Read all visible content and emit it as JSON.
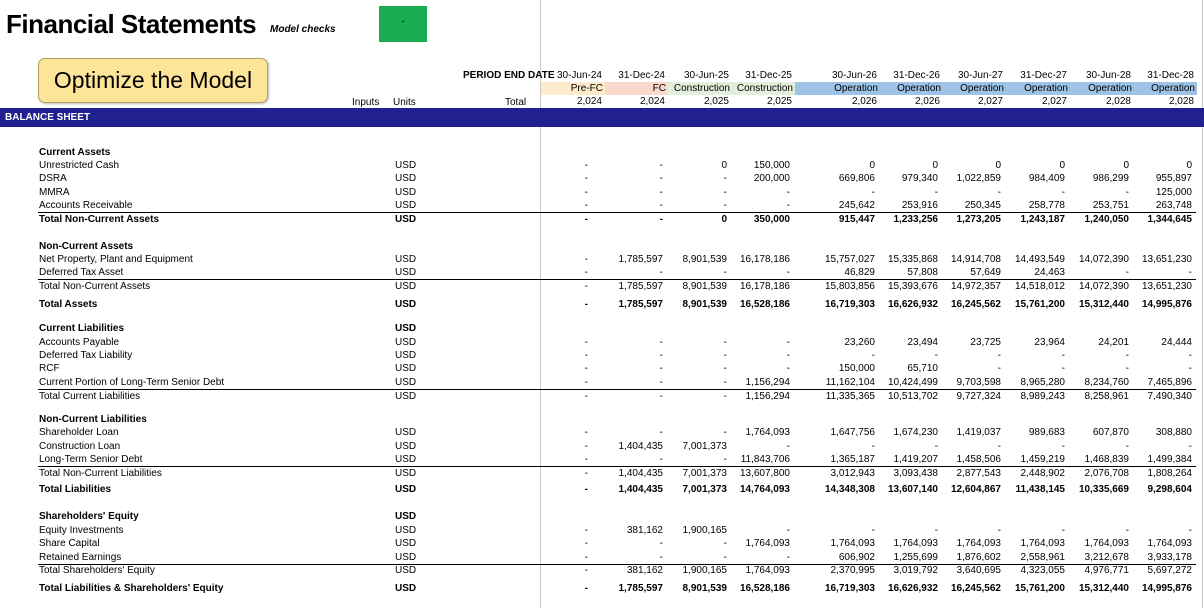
{
  "header": {
    "title": "Financial Statements",
    "model_checks_label": "Model checks",
    "model_checks_value": "-",
    "optimize_button": "Optimize the Model",
    "period_end_label": "PERIOD END DATE",
    "inputs_label": "Inputs",
    "units_label": "Units",
    "total_label": "Total"
  },
  "colors": {
    "section_bar": "#202090",
    "check_ok": "#1aae50",
    "button_fill": "#fce599",
    "phase_pre_fc": "#fdebcb",
    "phase_fc": "#f9d9cc",
    "phase_construction": "#e2efda",
    "phase_operation": "#9dc3e6"
  },
  "periods": [
    {
      "date": "30-Jun-24",
      "phase": "Pre-FC",
      "year": "2,024",
      "phase_color": "#fdebcb"
    },
    {
      "date": "31-Dec-24",
      "phase": "FC",
      "year": "2,024",
      "phase_color": "#f9d9cc"
    },
    {
      "date": "30-Jun-25",
      "phase": "Construction",
      "year": "2,025",
      "phase_color": "#e2efda"
    },
    {
      "date": "31-Dec-25",
      "phase": "Construction",
      "year": "2,025",
      "phase_color": "#e2efda"
    },
    {
      "date": "30-Jun-26",
      "phase": "Operation",
      "year": "2,026",
      "phase_color": "#9dc3e6"
    },
    {
      "date": "31-Dec-26",
      "phase": "Operation",
      "year": "2,026",
      "phase_color": "#9dc3e6"
    },
    {
      "date": "30-Jun-27",
      "phase": "Operation",
      "year": "2,027",
      "phase_color": "#9dc3e6"
    },
    {
      "date": "31-Dec-27",
      "phase": "Operation",
      "year": "2,027",
      "phase_color": "#9dc3e6"
    },
    {
      "date": "30-Jun-28",
      "phase": "Operation",
      "year": "2,028",
      "phase_color": "#9dc3e6"
    },
    {
      "date": "31-Dec-28",
      "phase": "Operation",
      "year": "2,028",
      "phase_color": "#9dc3e6"
    }
  ],
  "section_title": "BALANCE SHEET",
  "rows": [
    {
      "label": "Current Assets",
      "type": "heading"
    },
    {
      "label": "Unrestricted Cash",
      "units": "USD",
      "total": "-",
      "values": [
        "-",
        "0",
        "150,000",
        "0",
        "0",
        "0",
        "0",
        "0",
        "0"
      ]
    },
    {
      "label": "DSRA",
      "units": "USD",
      "total": "-",
      "values": [
        "-",
        "-",
        "200,000",
        "669,806",
        "979,340",
        "1,022,859",
        "984,409",
        "986,299",
        "955,897"
      ]
    },
    {
      "label": "MMRA",
      "units": "USD",
      "total": "-",
      "values": [
        "-",
        "-",
        "-",
        "-",
        "-",
        "-",
        "-",
        "-",
        "125,000"
      ]
    },
    {
      "label": "Accounts Receivable",
      "units": "USD",
      "total": "-",
      "values": [
        "-",
        "-",
        "-",
        "245,642",
        "253,916",
        "250,345",
        "258,778",
        "253,751",
        "263,748"
      ],
      "underline": true
    },
    {
      "label": "Total Non-Current Assets",
      "units": "USD",
      "total": "-",
      "values": [
        "-",
        "0",
        "350,000",
        "915,447",
        "1,233,256",
        "1,273,205",
        "1,243,187",
        "1,240,050",
        "1,344,645"
      ],
      "bold": true
    },
    {
      "label": "Non-Current Assets",
      "type": "heading"
    },
    {
      "label": "Net Property, Plant and Equipment",
      "units": "USD",
      "total": "-",
      "values": [
        "1,785,597",
        "8,901,539",
        "16,178,186",
        "15,757,027",
        "15,335,868",
        "14,914,708",
        "14,493,549",
        "14,072,390",
        "13,651,230"
      ]
    },
    {
      "label": "Deferred Tax Asset",
      "units": "USD",
      "total": "-",
      "values": [
        "-",
        "-",
        "-",
        "46,829",
        "57,808",
        "57,649",
        "24,463",
        "-",
        "-"
      ],
      "underline": true
    },
    {
      "label": "Total Non-Current Assets",
      "units": "USD",
      "total": "-",
      "values": [
        "1,785,597",
        "8,901,539",
        "16,178,186",
        "15,803,856",
        "15,393,676",
        "14,972,357",
        "14,518,012",
        "14,072,390",
        "13,651,230"
      ]
    },
    {
      "label": "Total Assets",
      "units": "USD",
      "total": "-",
      "values": [
        "1,785,597",
        "8,901,539",
        "16,528,186",
        "16,719,303",
        "16,626,932",
        "16,245,562",
        "15,761,200",
        "15,312,440",
        "14,995,876"
      ],
      "bold": true
    },
    {
      "label": "Current Liabilities",
      "type": "heading",
      "units": "USD"
    },
    {
      "label": "Accounts Payable",
      "units": "USD",
      "total": "-",
      "values": [
        "-",
        "-",
        "-",
        "23,260",
        "23,494",
        "23,725",
        "23,964",
        "24,201",
        "24,444"
      ]
    },
    {
      "label": "Deferred Tax Liability",
      "units": "USD",
      "total": "-",
      "values": [
        "-",
        "-",
        "-",
        "-",
        "-",
        "-",
        "-",
        "-",
        "-"
      ]
    },
    {
      "label": "RCF",
      "units": "USD",
      "total": "-",
      "values": [
        "-",
        "-",
        "-",
        "150,000",
        "65,710",
        "-",
        "-",
        "-",
        "-"
      ]
    },
    {
      "label": "Current Portion of Long-Term Senior Debt",
      "units": "USD",
      "total": "-",
      "values": [
        "-",
        "-",
        "1,156,294",
        "11,162,104",
        "10,424,499",
        "9,703,598",
        "8,965,280",
        "8,234,760",
        "7,465,896"
      ],
      "underline": true
    },
    {
      "label": "Total Current Liabilities",
      "units": "USD",
      "total": "-",
      "values": [
        "-",
        "-",
        "1,156,294",
        "11,335,365",
        "10,513,702",
        "9,727,324",
        "8,989,243",
        "8,258,961",
        "7,490,340"
      ]
    },
    {
      "label": "Non-Current Liabilities",
      "type": "heading"
    },
    {
      "label": "Shareholder Loan",
      "units": "USD",
      "total": "-",
      "values": [
        "-",
        "-",
        "1,764,093",
        "1,647,756",
        "1,674,230",
        "1,419,037",
        "989,683",
        "607,870",
        "308,880"
      ]
    },
    {
      "label": "Construction Loan",
      "units": "USD",
      "total": "-",
      "values": [
        "1,404,435",
        "7,001,373",
        "-",
        "-",
        "-",
        "-",
        "-",
        "-",
        "-"
      ]
    },
    {
      "label": "Long-Term Senior Debt",
      "units": "USD",
      "total": "-",
      "values": [
        "-",
        "-",
        "11,843,706",
        "1,365,187",
        "1,419,207",
        "1,458,506",
        "1,459,219",
        "1,468,839",
        "1,499,384"
      ],
      "underline": true
    },
    {
      "label": "Total Non-Current Liabilities",
      "units": "USD",
      "total": "-",
      "values": [
        "1,404,435",
        "7,001,373",
        "13,607,800",
        "3,012,943",
        "3,093,438",
        "2,877,543",
        "2,448,902",
        "2,076,708",
        "1,808,264"
      ]
    },
    {
      "label": "Total Liabilities",
      "units": "USD",
      "total": "-",
      "values": [
        "1,404,435",
        "7,001,373",
        "14,764,093",
        "14,348,308",
        "13,607,140",
        "12,604,867",
        "11,438,145",
        "10,335,669",
        "9,298,604"
      ],
      "bold": true
    },
    {
      "label": "Shareholders' Equity",
      "type": "heading",
      "units": "USD"
    },
    {
      "label": "Equity Investments",
      "units": "USD",
      "total": "-",
      "values": [
        "381,162",
        "1,900,165",
        "-",
        "-",
        "-",
        "-",
        "-",
        "-",
        "-"
      ]
    },
    {
      "label": "Share Capital",
      "units": "USD",
      "total": "-",
      "values": [
        "-",
        "-",
        "1,764,093",
        "1,764,093",
        "1,764,093",
        "1,764,093",
        "1,764,093",
        "1,764,093",
        "1,764,093"
      ]
    },
    {
      "label": "Retained Earnings",
      "units": "USD",
      "total": "-",
      "values": [
        "-",
        "-",
        "-",
        "606,902",
        "1,255,699",
        "1,876,602",
        "2,558,961",
        "3,212,678",
        "3,933,178"
      ],
      "underline": true
    },
    {
      "label": "Total Shareholders' Equity",
      "units": "USD",
      "total": "-",
      "values": [
        "381,162",
        "1,900,165",
        "1,764,093",
        "2,370,995",
        "3,019,792",
        "3,640,695",
        "4,323,055",
        "4,976,771",
        "5,697,272"
      ]
    },
    {
      "label": "Total Liabilities & Shareholders' Equity",
      "units": "USD",
      "total": "-",
      "values": [
        "1,785,597",
        "8,901,539",
        "16,528,186",
        "16,719,303",
        "16,626,932",
        "16,245,562",
        "15,761,200",
        "15,312,440",
        "14,995,876"
      ],
      "bold": true
    }
  ]
}
